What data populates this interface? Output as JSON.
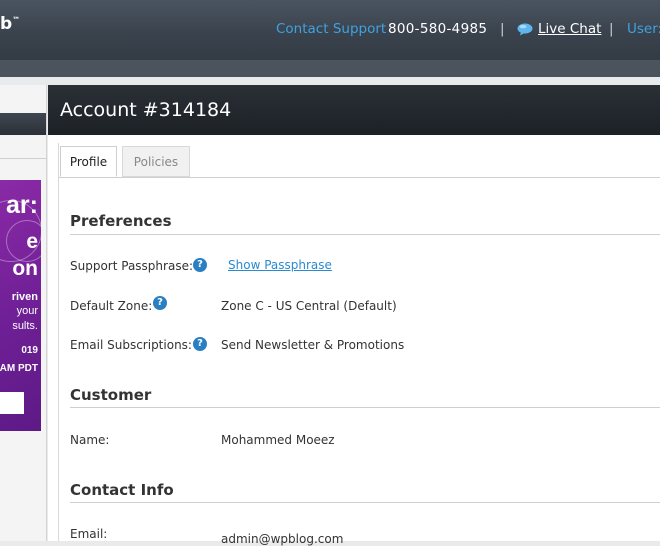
{
  "header": {
    "logo_fragment": "b",
    "logo_mark": "™",
    "contact_label": "Contact Support",
    "phone": "800-580-4985",
    "separator": "|",
    "live_chat": "Live Chat",
    "user_label": "User:"
  },
  "sidebar": {
    "promo": {
      "line1": "ar:",
      "line2": "e",
      "line3": "on",
      "line4": "riven",
      "line5": "your",
      "line6": "sults.",
      "line7": "019",
      "line8": "AM PDT"
    }
  },
  "account": {
    "title": "Account #314184"
  },
  "tabs": [
    {
      "label": "Profile",
      "active": true
    },
    {
      "label": "Policies",
      "active": false
    }
  ],
  "preferences": {
    "heading": "Preferences",
    "passphrase_label": "Support Passphrase:",
    "passphrase_link": "Show Passphrase",
    "zone_label": "Default Zone:",
    "zone_value": "Zone C - US Central (Default)",
    "email_sub_label": "Email Subscriptions:",
    "email_sub_value": "Send Newsletter & Promotions"
  },
  "customer": {
    "heading": "Customer",
    "name_label": "Name:",
    "name_value": "Mohammed Moeez"
  },
  "contact_info": {
    "heading": "Contact Info",
    "email_label": "Email:",
    "email_value": "admin@wpblog.com"
  },
  "colors": {
    "accent_blue": "#3fa2e0",
    "link_blue": "#2a8ad0",
    "promo_purple": "#7a249d",
    "header_dark": "#3a434d"
  }
}
